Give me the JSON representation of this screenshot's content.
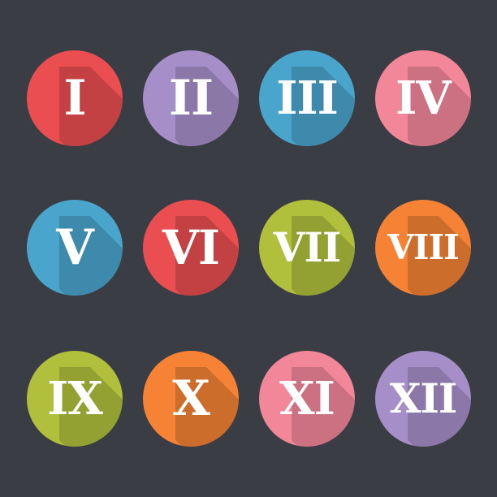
{
  "background": "#3b3d45",
  "icons": [
    {
      "label": "I",
      "color": "#ea4e50"
    },
    {
      "label": "II",
      "color": "#a68fc9"
    },
    {
      "label": "III",
      "color": "#4aa5cd"
    },
    {
      "label": "IV",
      "color": "#f2879a"
    },
    {
      "label": "V",
      "color": "#4aa5cd"
    },
    {
      "label": "VI",
      "color": "#ea4e50"
    },
    {
      "label": "VII",
      "color": "#b0bf3c"
    },
    {
      "label": "VIII",
      "color": "#f58235"
    },
    {
      "label": "IX",
      "color": "#b0bf3c"
    },
    {
      "label": "X",
      "color": "#f58235"
    },
    {
      "label": "XI",
      "color": "#f2879a"
    },
    {
      "label": "XII",
      "color": "#a68fc9"
    }
  ]
}
